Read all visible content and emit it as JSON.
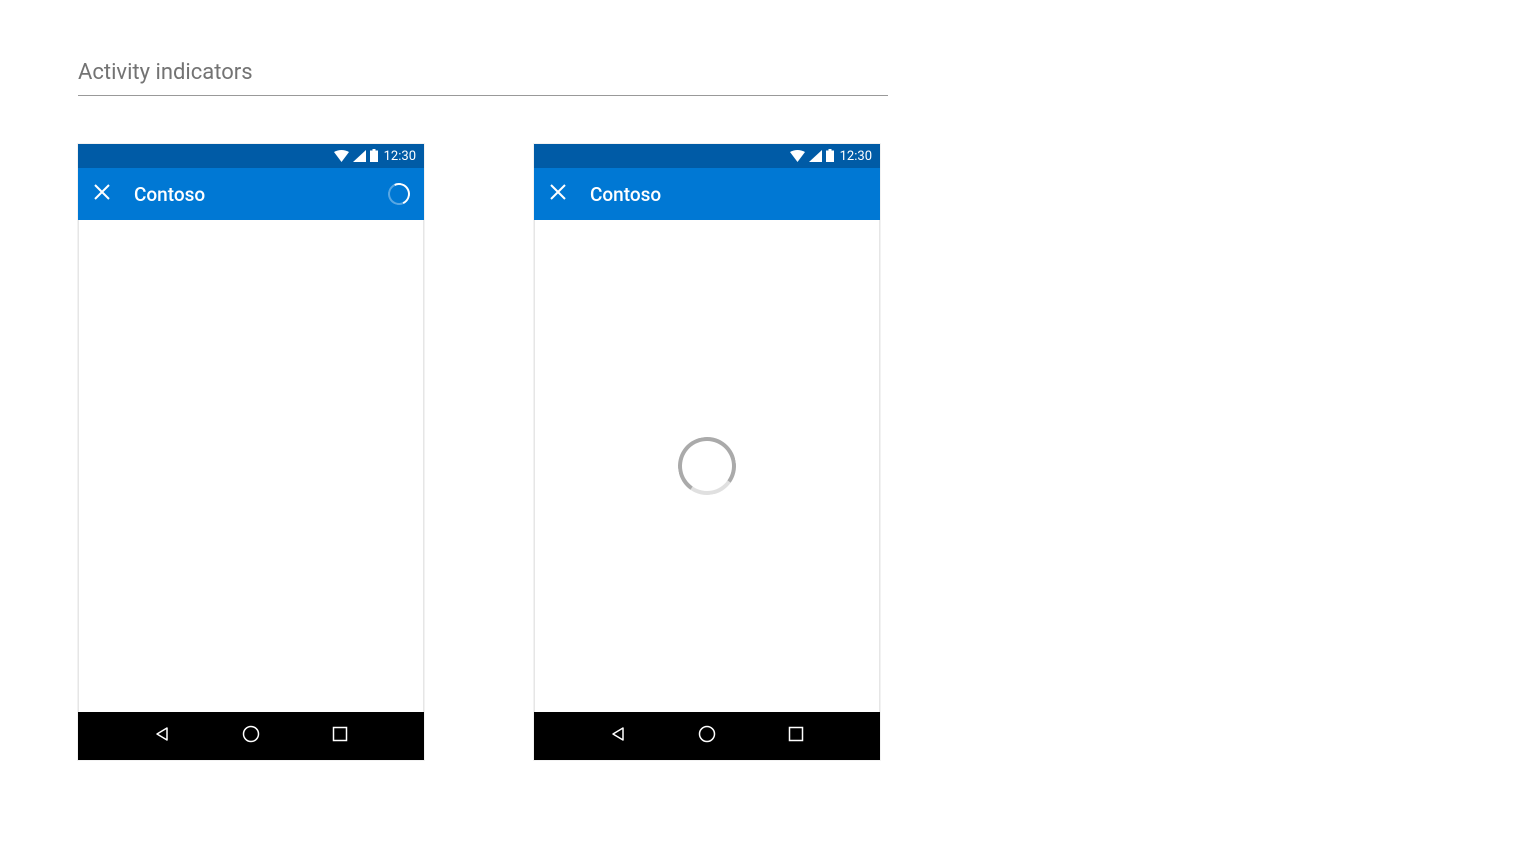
{
  "page": {
    "title": "Activity indicators"
  },
  "phones": [
    {
      "status_time": "12:30",
      "app_title": "Contoso",
      "show_appbar_spinner": true,
      "show_content_spinner": false
    },
    {
      "status_time": "12:30",
      "app_title": "Contoso",
      "show_appbar_spinner": false,
      "show_content_spinner": true
    }
  ],
  "colors": {
    "status_bar": "#005ba6",
    "app_bar": "#0078d4",
    "nav_bar": "#000000"
  }
}
